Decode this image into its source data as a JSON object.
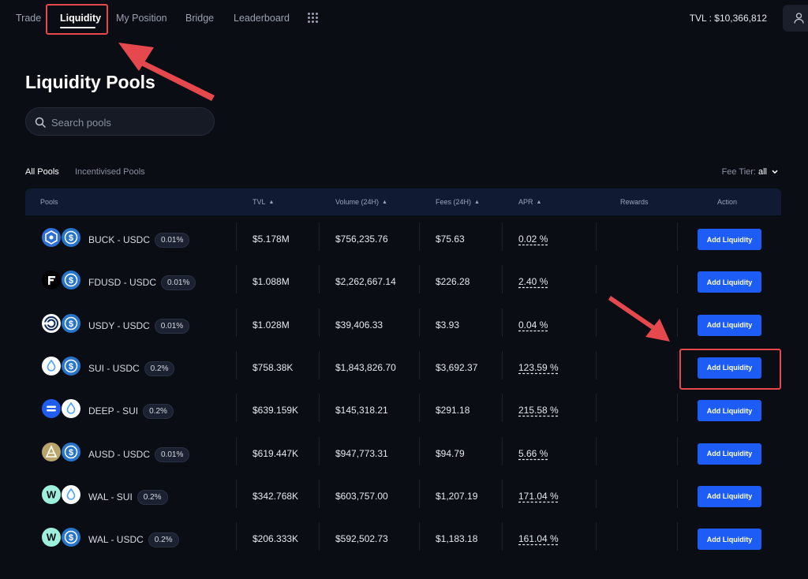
{
  "nav": {
    "items": [
      "Trade",
      "Liquidity",
      "My Position",
      "Bridge",
      "Leaderboard"
    ],
    "active": "Liquidity",
    "tvl_label": "TVL : $10,366,812"
  },
  "page": {
    "title": "Liquidity Pools",
    "search_placeholder": "Search pools"
  },
  "filters": {
    "tabs": [
      "All Pools",
      "Incentivised Pools"
    ],
    "fee_tier_label": "Fee Tier:",
    "fee_tier_value": "all"
  },
  "table": {
    "headers": [
      "Pools",
      "TVL",
      "Volume (24H)",
      "Fees (24H)",
      "APR",
      "Rewards",
      "Action"
    ],
    "action_label": "Add Liquidity",
    "rows": [
      {
        "pair": "BUCK - USDC",
        "fee": "0.01%",
        "tvl": "$5.178M",
        "volume": "$756,235.76",
        "fees": "$75.63",
        "apr": "0.02 %",
        "coin1": "buck",
        "coin2": "usdc"
      },
      {
        "pair": "FDUSD - USDC",
        "fee": "0.01%",
        "tvl": "$1.088M",
        "volume": "$2,262,667.14",
        "fees": "$226.28",
        "apr": "2.40 %",
        "coin1": "fdusd",
        "coin2": "usdc"
      },
      {
        "pair": "USDY - USDC",
        "fee": "0.01%",
        "tvl": "$1.028M",
        "volume": "$39,406.33",
        "fees": "$3.93",
        "apr": "0.04 %",
        "coin1": "usdy",
        "coin2": "usdc"
      },
      {
        "pair": "SUI - USDC",
        "fee": "0.2%",
        "tvl": "$758.38K",
        "volume": "$1,843,826.70",
        "fees": "$3,692.37",
        "apr": "123.59 %",
        "coin1": "sui",
        "coin2": "usdc"
      },
      {
        "pair": "DEEP - SUI",
        "fee": "0.2%",
        "tvl": "$639.159K",
        "volume": "$145,318.21",
        "fees": "$291.18",
        "apr": "215.58 %",
        "coin1": "deep",
        "coin2": "sui"
      },
      {
        "pair": "AUSD - USDC",
        "fee": "0.01%",
        "tvl": "$619.447K",
        "volume": "$947,773.31",
        "fees": "$94.79",
        "apr": "5.66 %",
        "coin1": "ausd",
        "coin2": "usdc"
      },
      {
        "pair": "WAL - SUI",
        "fee": "0.2%",
        "tvl": "$342.768K",
        "volume": "$603,757.00",
        "fees": "$1,207.19",
        "apr": "171.04 %",
        "coin1": "wal",
        "coin2": "sui"
      },
      {
        "pair": "WAL - USDC",
        "fee": "0.2%",
        "tvl": "$206.333K",
        "volume": "$592,502.73",
        "fees": "$1,183.18",
        "apr": "161.04 %",
        "coin1": "wal",
        "coin2": "usdc"
      }
    ]
  },
  "colors": {
    "background": "#0a0d14",
    "accent": "#1d5cf5",
    "annotation": "#e5484d",
    "usdc": "#2775ca",
    "sui": "#4da2ff"
  },
  "icons": {
    "search": "search-icon",
    "user": "user-icon",
    "apps": "grid-icon",
    "chevron": "chevron-down-icon"
  }
}
